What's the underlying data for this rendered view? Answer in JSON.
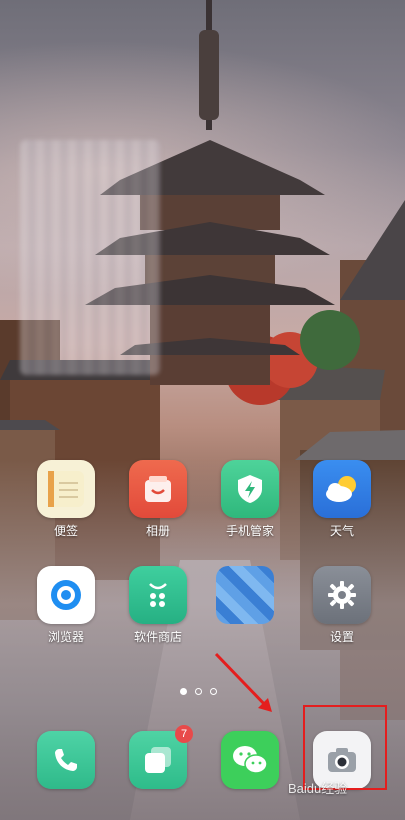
{
  "apps": {
    "notes": {
      "label": "便签",
      "icon": "notes-icon"
    },
    "gallery": {
      "label": "相册",
      "icon": "gallery-icon"
    },
    "phone_manager": {
      "label": "手机管家",
      "icon": "shield-icon"
    },
    "weather": {
      "label": "天气",
      "icon": "weather-icon"
    },
    "browser": {
      "label": "浏览器",
      "icon": "browser-icon"
    },
    "app_store": {
      "label": "软件商店",
      "icon": "store-icon"
    },
    "blurred_app": {
      "label": ""
    },
    "settings": {
      "label": "设置",
      "icon": "gear-icon"
    }
  },
  "dock": {
    "phone": {
      "icon": "phone-icon"
    },
    "multitask": {
      "icon": "multitask-icon",
      "badge": "7"
    },
    "wechat": {
      "icon": "wechat-icon"
    },
    "camera": {
      "icon": "camera-icon"
    }
  },
  "page_indicator": {
    "pages": 3,
    "active": 1
  },
  "watermark": "Baidu经验",
  "colors": {
    "highlight": "#e41e1e",
    "badge": "#e84a4a"
  }
}
